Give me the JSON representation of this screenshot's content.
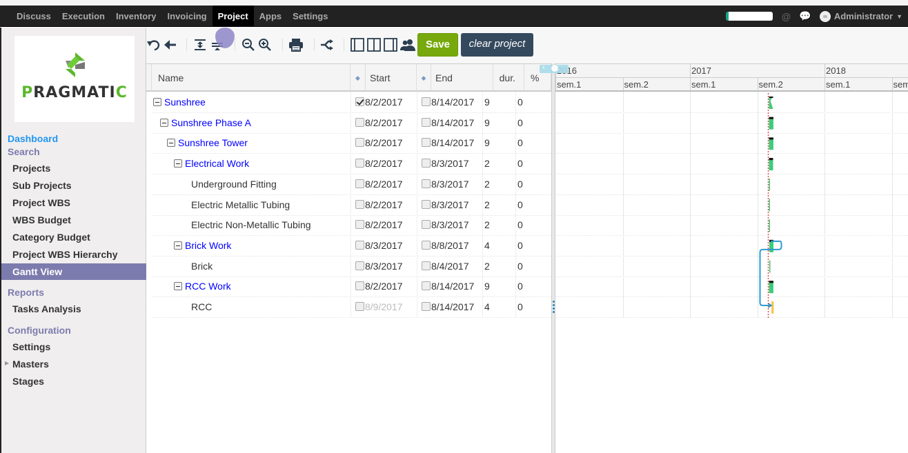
{
  "navbar": {
    "menu": [
      {
        "label": "Discuss",
        "active": false
      },
      {
        "label": "Execution",
        "active": false
      },
      {
        "label": "Inventory",
        "active": false
      },
      {
        "label": "Invoicing",
        "active": false
      },
      {
        "label": "Project",
        "active": true
      },
      {
        "label": "Apps",
        "active": false
      },
      {
        "label": "Settings",
        "active": false
      }
    ],
    "user": "Administrator"
  },
  "logo": {
    "text_first": "P",
    "text_rest": "RAGMATI",
    "text_last": "C"
  },
  "sidebar": {
    "dashboard": "Dashboard",
    "search_section": "Search",
    "search_items": [
      "Projects",
      "Sub Projects",
      "Project WBS",
      "WBS Budget",
      "Category Budget",
      "Project WBS Hierarchy",
      "Gantt View"
    ],
    "active_item": "Gantt View",
    "reports_section": "Reports",
    "reports_items": [
      "Tasks Analysis"
    ],
    "config_section": "Configuration",
    "config_items": [
      "Settings",
      "Masters",
      "Stages"
    ]
  },
  "toolbar": {
    "icons": [
      "undo-icon",
      "back-arrow-icon",
      "expand-all-icon",
      "collapse-all-icon",
      "zoom-out-icon",
      "zoom-in-icon",
      "print-icon",
      "critical-path-icon",
      "left-panel-icon",
      "split-panel-icon",
      "right-panel-icon",
      "resources-icon"
    ],
    "save_label": "Save",
    "clear_label": "clear project"
  },
  "grid": {
    "headers": {
      "name": "Name",
      "start": "Start",
      "end": "End",
      "dur": "dur.",
      "pct": "%"
    },
    "rows": [
      {
        "name": "Sunshree",
        "level": 0,
        "group": true,
        "start_milestone": true,
        "start": "8/2/2017",
        "end_milestone": false,
        "end": "8/14/2017",
        "dur": "9",
        "pct": "0"
      },
      {
        "name": "Sunshree Phase A",
        "level": 1,
        "group": true,
        "start_milestone": false,
        "start": "8/2/2017",
        "end_milestone": false,
        "end": "8/14/2017",
        "dur": "9",
        "pct": "0"
      },
      {
        "name": "Sunshree Tower",
        "level": 2,
        "group": true,
        "start_milestone": false,
        "start": "8/2/2017",
        "end_milestone": false,
        "end": "8/14/2017",
        "dur": "9",
        "pct": "0"
      },
      {
        "name": "Electrical Work",
        "level": 3,
        "group": true,
        "start_milestone": false,
        "start": "8/2/2017",
        "end_milestone": false,
        "end": "8/3/2017",
        "dur": "2",
        "pct": "0"
      },
      {
        "name": "Underground Fitting",
        "level": 4,
        "group": false,
        "start_milestone": false,
        "start": "8/2/2017",
        "end_milestone": false,
        "end": "8/3/2017",
        "dur": "2",
        "pct": "0"
      },
      {
        "name": "Electric Metallic Tubing",
        "level": 4,
        "group": false,
        "start_milestone": false,
        "start": "8/2/2017",
        "end_milestone": false,
        "end": "8/3/2017",
        "dur": "2",
        "pct": "0"
      },
      {
        "name": "Electric Non-Metallic Tubing",
        "level": 4,
        "group": false,
        "start_milestone": false,
        "start": "8/2/2017",
        "end_milestone": false,
        "end": "8/3/2017",
        "dur": "2",
        "pct": "0"
      },
      {
        "name": "Brick Work",
        "level": 3,
        "group": true,
        "start_milestone": false,
        "start": "8/3/2017",
        "end_milestone": false,
        "end": "8/8/2017",
        "dur": "4",
        "pct": "0"
      },
      {
        "name": "Brick",
        "level": 4,
        "group": false,
        "start_milestone": false,
        "start": "8/3/2017",
        "end_milestone": false,
        "end": "8/4/2017",
        "dur": "2",
        "pct": "0"
      },
      {
        "name": "RCC Work",
        "level": 3,
        "group": true,
        "start_milestone": false,
        "start": "8/2/2017",
        "end_milestone": false,
        "end": "8/14/2017",
        "dur": "9",
        "pct": "0"
      },
      {
        "name": "RCC",
        "level": 4,
        "group": false,
        "start_milestone": false,
        "start": "8/9/2017",
        "start_disabled": true,
        "end_milestone": false,
        "end": "8/14/2017",
        "dur": "4",
        "pct": "0"
      }
    ]
  },
  "gantt": {
    "years": [
      "2016",
      "2017",
      "2018"
    ],
    "semesters": [
      "sem.1",
      "sem.2",
      "sem.1",
      "sem.2",
      "sem.1",
      "sem"
    ],
    "colors": {
      "bar": "#3ccc7c",
      "bar_top": "#111111",
      "today_line": "#e84c4c",
      "link": "#2c9ad1",
      "late_bar": "#f7c041"
    }
  }
}
